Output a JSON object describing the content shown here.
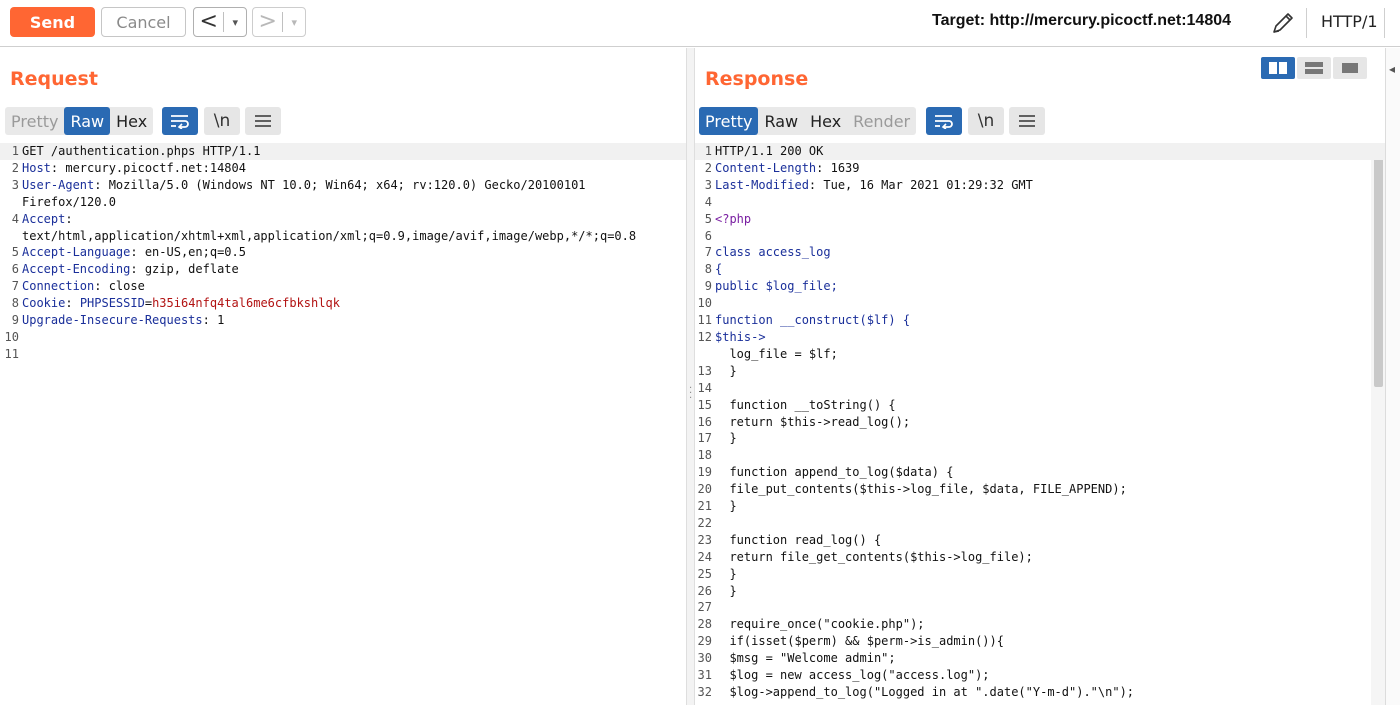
{
  "toolbar": {
    "send_label": "Send",
    "cancel_label": "Cancel",
    "back_label": "<",
    "forward_label": ">",
    "dropdown_glyph": "▾",
    "target_text": "Target: http://mercury.picoctf.net:14804",
    "http_version": "HTTP/1"
  },
  "request": {
    "title": "Request",
    "tabs": [
      {
        "label": "Pretty",
        "state": "disabled"
      },
      {
        "label": "Raw",
        "state": "active"
      },
      {
        "label": "Hex",
        "state": "normal"
      }
    ],
    "newline_label": "\\n",
    "lines": [
      {
        "n": "1",
        "parts": [
          {
            "t": "GET /authentication.phps HTTP/1.1",
            "c": "plain"
          }
        ]
      },
      {
        "n": "2",
        "parts": [
          {
            "t": "Host",
            "c": "hdr"
          },
          {
            "t": ": mercury.picoctf.net:14804",
            "c": "plain"
          }
        ]
      },
      {
        "n": "3",
        "parts": [
          {
            "t": "User-Agent",
            "c": "hdr"
          },
          {
            "t": ": Mozilla/5.0 (Windows NT 10.0; Win64; x64; rv:120.0) Gecko/20100101",
            "c": "plain"
          }
        ]
      },
      {
        "n": "",
        "parts": [
          {
            "t": "Firefox/120.0",
            "c": "plain"
          }
        ]
      },
      {
        "n": "4",
        "parts": [
          {
            "t": "Accept",
            "c": "hdr"
          },
          {
            "t": ":",
            "c": "plain"
          }
        ]
      },
      {
        "n": "",
        "parts": [
          {
            "t": "text/html,application/xhtml+xml,application/xml;q=0.9,image/avif,image/webp,*/*;q=0.8",
            "c": "plain"
          }
        ]
      },
      {
        "n": "5",
        "parts": [
          {
            "t": "Accept-Language",
            "c": "hdr"
          },
          {
            "t": ": en-US,en;q=0.5",
            "c": "plain"
          }
        ]
      },
      {
        "n": "6",
        "parts": [
          {
            "t": "Accept-Encoding",
            "c": "hdr"
          },
          {
            "t": ": gzip, deflate",
            "c": "plain"
          }
        ]
      },
      {
        "n": "7",
        "parts": [
          {
            "t": "Connection",
            "c": "hdr"
          },
          {
            "t": ": close",
            "c": "plain"
          }
        ]
      },
      {
        "n": "8",
        "parts": [
          {
            "t": "Cookie",
            "c": "hdr"
          },
          {
            "t": ": ",
            "c": "plain"
          },
          {
            "t": "PHPSESSID",
            "c": "hdr"
          },
          {
            "t": "=",
            "c": "plain"
          },
          {
            "t": "h35i64nfq4tal6me6cfbkshlqk",
            "c": "ck"
          }
        ]
      },
      {
        "n": "9",
        "parts": [
          {
            "t": "Upgrade-Insecure-Requests",
            "c": "hdr"
          },
          {
            "t": ": 1",
            "c": "plain"
          }
        ]
      },
      {
        "n": "10",
        "parts": []
      },
      {
        "n": "11",
        "parts": []
      }
    ]
  },
  "response": {
    "title": "Response",
    "tabs": [
      {
        "label": "Pretty",
        "state": "active"
      },
      {
        "label": "Raw",
        "state": "normal"
      },
      {
        "label": "Hex",
        "state": "normal"
      },
      {
        "label": "Render",
        "state": "disabled"
      }
    ],
    "newline_label": "\\n",
    "lines": [
      {
        "n": "1",
        "parts": [
          {
            "t": "HTTP/1.1 200 OK",
            "c": "plain"
          }
        ]
      },
      {
        "n": "2",
        "parts": [
          {
            "t": "Content-Length",
            "c": "hdr"
          },
          {
            "t": ": 1639",
            "c": "plain"
          }
        ]
      },
      {
        "n": "3",
        "parts": [
          {
            "t": "Last-Modified",
            "c": "hdr"
          },
          {
            "t": ": Tue, 16 Mar 2021 01:29:32 GMT",
            "c": "plain"
          }
        ]
      },
      {
        "n": "4",
        "parts": []
      },
      {
        "n": "5",
        "parts": [
          {
            "t": "<?php",
            "c": "kw"
          }
        ]
      },
      {
        "n": "6",
        "parts": []
      },
      {
        "n": "7",
        "parts": [
          {
            "t": "class access_log",
            "c": "hdr"
          }
        ]
      },
      {
        "n": "8",
        "parts": [
          {
            "t": "{",
            "c": "hdr"
          }
        ]
      },
      {
        "n": "9",
        "parts": [
          {
            "t": "public $log_file;",
            "c": "hdr"
          }
        ]
      },
      {
        "n": "10",
        "parts": []
      },
      {
        "n": "11",
        "parts": [
          {
            "t": "function __construct($lf) {",
            "c": "hdr"
          }
        ]
      },
      {
        "n": "12",
        "parts": [
          {
            "t": "$this->",
            "c": "hdr"
          }
        ]
      },
      {
        "n": "",
        "parts": [
          {
            "t": "  log_file = $lf;",
            "c": "plain"
          }
        ]
      },
      {
        "n": "13",
        "parts": [
          {
            "t": "  }",
            "c": "plain"
          }
        ]
      },
      {
        "n": "14",
        "parts": []
      },
      {
        "n": "15",
        "parts": [
          {
            "t": "  function __toString() {",
            "c": "plain"
          }
        ]
      },
      {
        "n": "16",
        "parts": [
          {
            "t": "  return $this->read_log();",
            "c": "plain"
          }
        ]
      },
      {
        "n": "17",
        "parts": [
          {
            "t": "  }",
            "c": "plain"
          }
        ]
      },
      {
        "n": "18",
        "parts": []
      },
      {
        "n": "19",
        "parts": [
          {
            "t": "  function append_to_log($data) {",
            "c": "plain"
          }
        ]
      },
      {
        "n": "20",
        "parts": [
          {
            "t": "  file_put_contents($this->log_file, $data, FILE_APPEND);",
            "c": "plain"
          }
        ]
      },
      {
        "n": "21",
        "parts": [
          {
            "t": "  }",
            "c": "plain"
          }
        ]
      },
      {
        "n": "22",
        "parts": []
      },
      {
        "n": "23",
        "parts": [
          {
            "t": "  function read_log() {",
            "c": "plain"
          }
        ]
      },
      {
        "n": "24",
        "parts": [
          {
            "t": "  return file_get_contents($this->log_file);",
            "c": "plain"
          }
        ]
      },
      {
        "n": "25",
        "parts": [
          {
            "t": "  }",
            "c": "plain"
          }
        ]
      },
      {
        "n": "26",
        "parts": [
          {
            "t": "  }",
            "c": "plain"
          }
        ]
      },
      {
        "n": "27",
        "parts": []
      },
      {
        "n": "28",
        "parts": [
          {
            "t": "  require_once(\"cookie.php\");",
            "c": "plain"
          }
        ]
      },
      {
        "n": "29",
        "parts": [
          {
            "t": "  if(isset($perm) && $perm->is_admin()){",
            "c": "plain"
          }
        ]
      },
      {
        "n": "30",
        "parts": [
          {
            "t": "  $msg = \"Welcome admin\";",
            "c": "plain"
          }
        ]
      },
      {
        "n": "31",
        "parts": [
          {
            "t": "  $log = new access_log(\"access.log\");",
            "c": "plain"
          }
        ]
      },
      {
        "n": "32",
        "parts": [
          {
            "t": "  $log->append_to_log(\"Logged in at \".date(\"Y-m-d\").\"\\n\");",
            "c": "plain"
          }
        ]
      }
    ]
  },
  "icons": [
    "pencil-icon",
    "wrap-icon",
    "menu-icon",
    "split-horizontal-icon",
    "split-vertical-icon",
    "single-pane-icon"
  ],
  "colors": {
    "accent": "#ff6633",
    "active_tab": "#2a6ab3",
    "header_name": "#1a2f9a",
    "cookie_value": "#b21212",
    "php_tag": "#7a1fa2"
  }
}
